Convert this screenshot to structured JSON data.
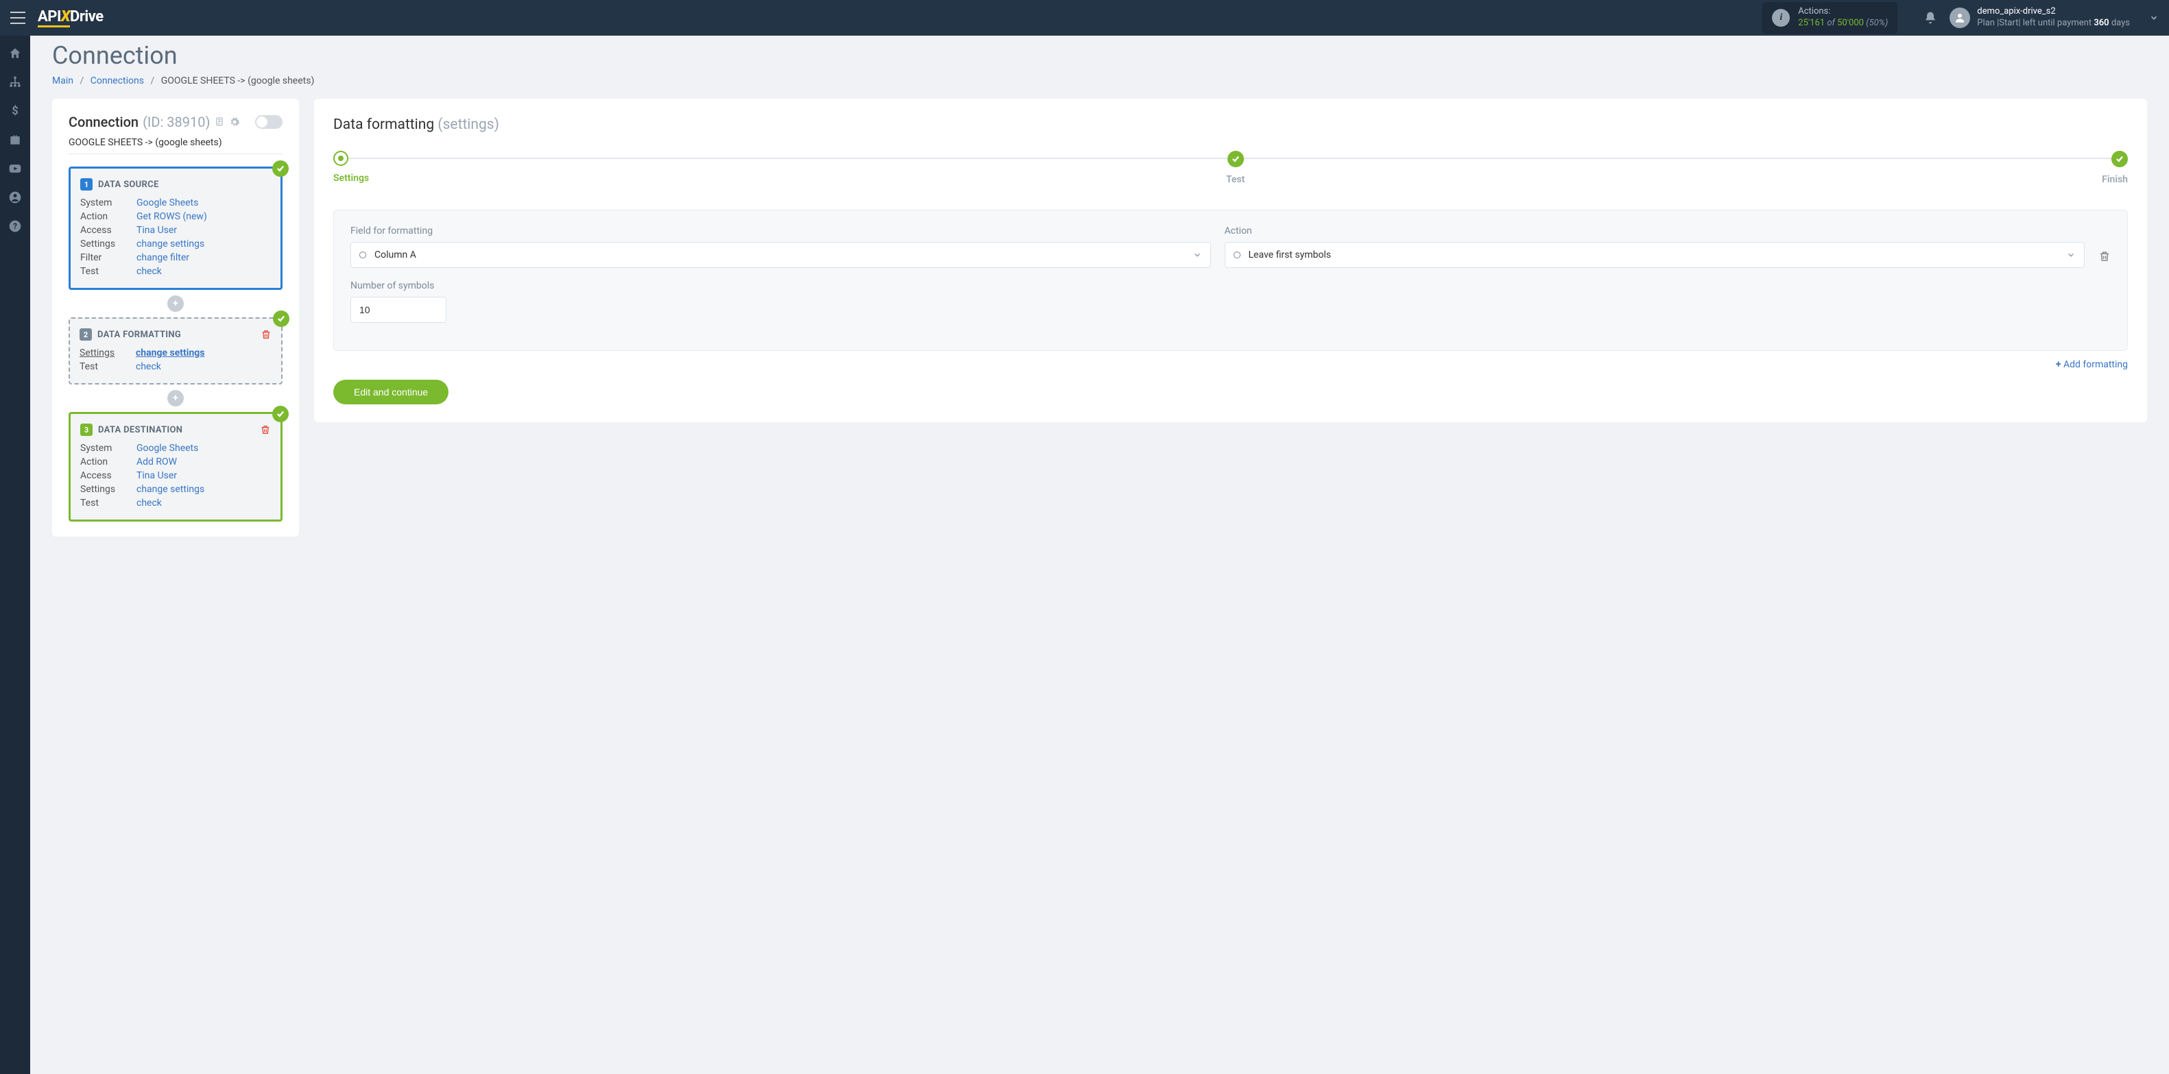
{
  "header": {
    "logo_api": "API",
    "logo_drive": "Drive",
    "actions_label": "Actions:",
    "actions_current": "25'161",
    "actions_of": "of",
    "actions_total": "50'000",
    "actions_pct": "(50%)",
    "user_name": "demo_apix-drive_s2",
    "plan_prefix": "Plan |Start| left until payment",
    "plan_days": "360",
    "plan_suffix": "days"
  },
  "page": {
    "title": "Connection",
    "crumb_main": "Main",
    "crumb_connections": "Connections",
    "crumb_current": "GOOGLE SHEETS -> (google sheets)"
  },
  "left": {
    "conn_label": "Connection",
    "conn_id": "(ID: 38910)",
    "conn_sub": "GOOGLE SHEETS -> (google sheets)",
    "block1": {
      "title": "DATA SOURCE",
      "rows": [
        {
          "label": "System",
          "value": "Google Sheets"
        },
        {
          "label": "Action",
          "value": "Get ROWS (new)"
        },
        {
          "label": "Access",
          "value": "Tina User"
        },
        {
          "label": "Settings",
          "value": "change settings"
        },
        {
          "label": "Filter",
          "value": "change filter"
        },
        {
          "label": "Test",
          "value": "check"
        }
      ]
    },
    "block2": {
      "title": "DATA FORMATTING",
      "rows": [
        {
          "label": "Settings",
          "value": "change settings"
        },
        {
          "label": "Test",
          "value": "check"
        }
      ]
    },
    "block3": {
      "title": "DATA DESTINATION",
      "rows": [
        {
          "label": "System",
          "value": "Google Sheets"
        },
        {
          "label": "Action",
          "value": "Add ROW"
        },
        {
          "label": "Access",
          "value": "Tina User"
        },
        {
          "label": "Settings",
          "value": "change settings"
        },
        {
          "label": "Test",
          "value": "check"
        }
      ]
    }
  },
  "right": {
    "title_main": "Data formatting",
    "title_sub": "(settings)",
    "step1": "Settings",
    "step2": "Test",
    "step3": "Finish",
    "label_field": "Field for formatting",
    "label_action": "Action",
    "label_number": "Number of symbols",
    "select_field": "Column A",
    "select_action": "Leave first symbols",
    "input_number": "10",
    "add_formatting": "Add formatting",
    "continue": "Edit and continue"
  }
}
